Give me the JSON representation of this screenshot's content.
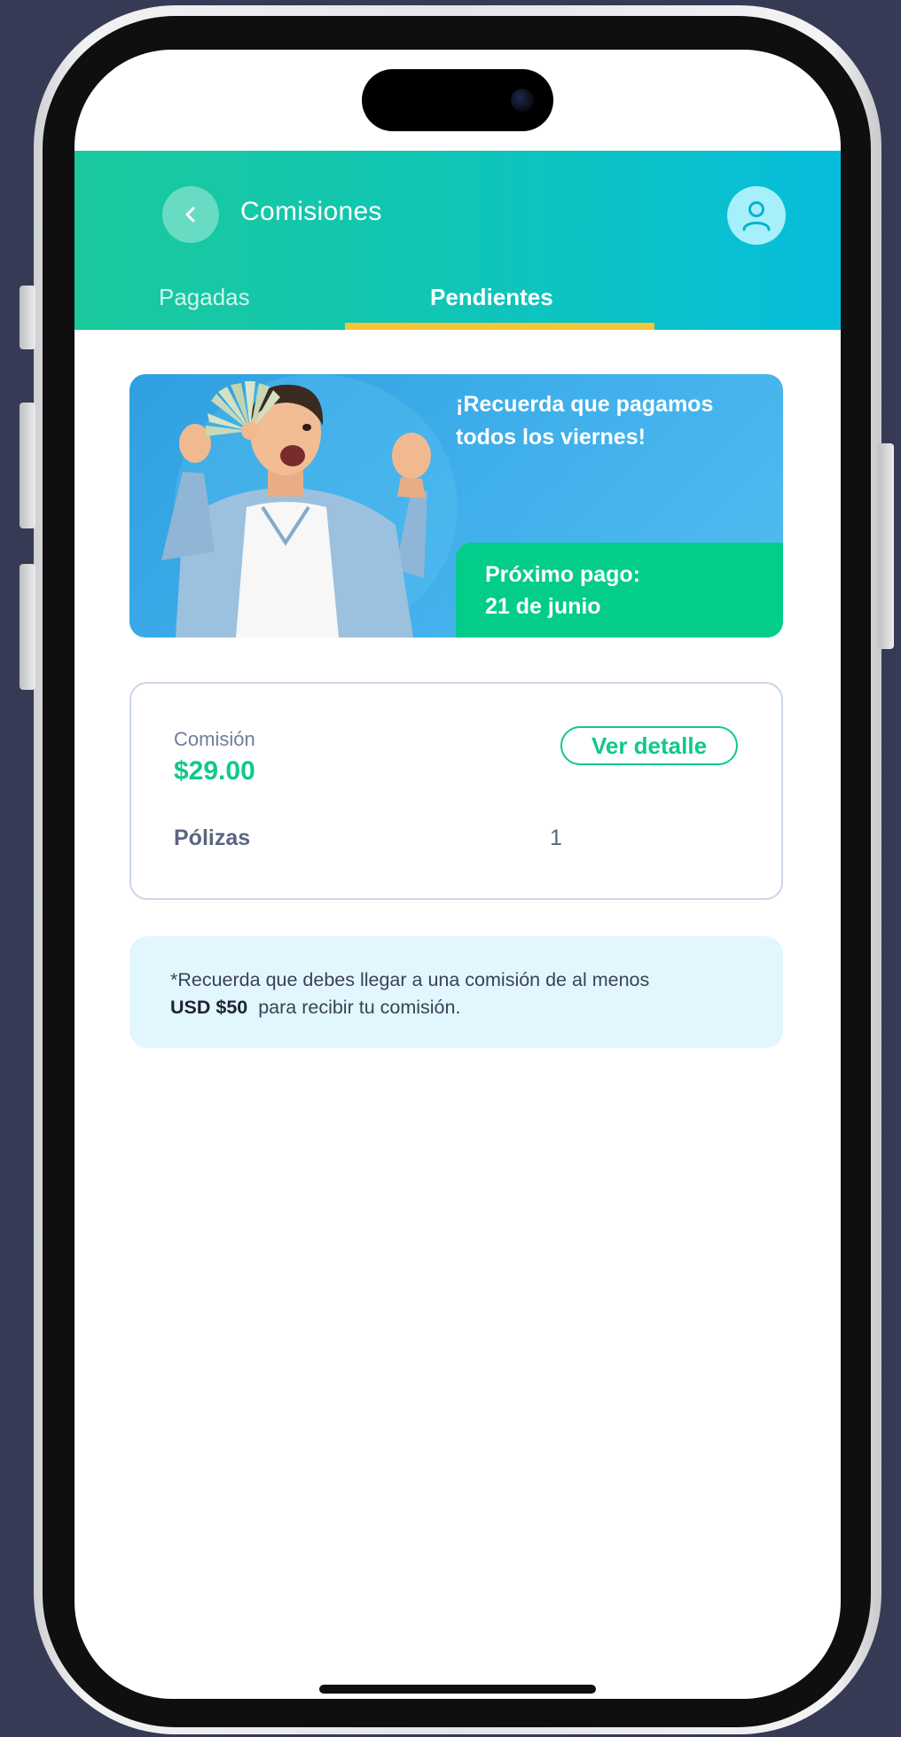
{
  "header": {
    "title": "Comisiones",
    "back_icon": "chevron-left-icon",
    "profile_icon": "user-icon"
  },
  "tabs": [
    {
      "label": "Pagadas",
      "active": false
    },
    {
      "label": "Pendientes",
      "active": true
    }
  ],
  "banner": {
    "message_line1": "¡Recuerda que pagamos",
    "message_line2": "todos los viernes!",
    "next_payment_label": "Próximo pago:",
    "next_payment_date": "21 de junio"
  },
  "commission_card": {
    "label": "Comisión",
    "amount": "$29.00",
    "detail_button": "Ver detalle",
    "policies_label": "Pólizas",
    "policies_value": "1"
  },
  "note": {
    "text_before": "*Recuerda que debes llegar a una comisión de al menos",
    "amount": "USD $50",
    "text_after": "para recibir tu comisión."
  },
  "colors": {
    "brand_green": "#0fc98a",
    "header_gradient_start": "#1bc99c",
    "header_gradient_end": "#05bedc",
    "tab_indicator": "#f6c43a",
    "banner_blue": "#3eaeea",
    "note_background": "#e2f7fd"
  }
}
